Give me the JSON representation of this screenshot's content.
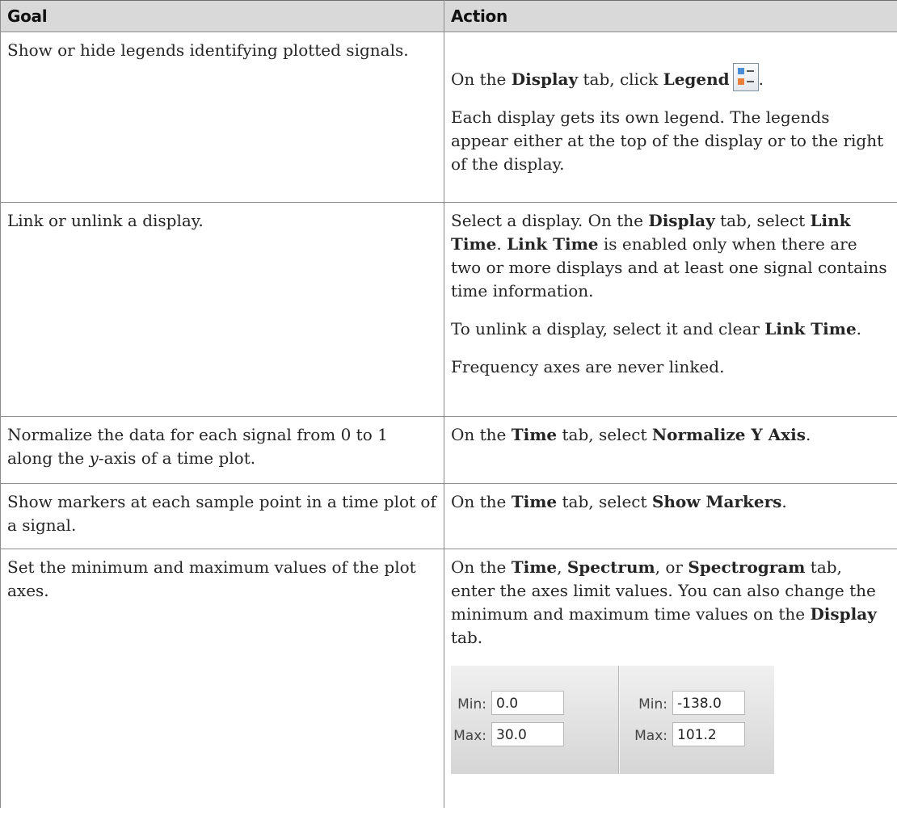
{
  "table": {
    "headers": {
      "goal": "Goal",
      "action": "Action"
    },
    "rows": [
      {
        "goal": "Show or hide legends identifying plotted signals.",
        "action1": {
          "t1": "On the ",
          "b1": "Display",
          "t2": " tab, click ",
          "b2": "Legend",
          "icon": "legend-icon",
          "end": "."
        },
        "action2": "Each display gets its own legend. The legends appear either at the top of the display or to the right of the display."
      },
      {
        "goal": "Link or unlink a display.",
        "action1": {
          "t1": "Select a display. On the ",
          "b1": "Display",
          "t2": " tab, select ",
          "b2": "Link Time",
          "t3": ". ",
          "b3": "Link Time",
          "t4": " is enabled only when there are two or more displays and at least one signal contains time information."
        },
        "action2": {
          "t1": "To unlink a display, select it and clear ",
          "b1": "Link Time",
          "end": "."
        },
        "action3": "Frequency axes are never linked."
      },
      {
        "goal": {
          "t1": "Normalize the data for each signal from 0 to 1 along the ",
          "i1": "y",
          "t2": "-axis of a time plot."
        },
        "action1": {
          "t1": "On the ",
          "b1": "Time",
          "t2": " tab, select ",
          "b2": "Normalize Y Axis",
          "end": "."
        }
      },
      {
        "goal": "Show markers at each sample point in a time plot of a signal.",
        "action1": {
          "t1": "On the ",
          "b1": "Time",
          "t2": " tab, select ",
          "b2": "Show Markers",
          "end": "."
        }
      },
      {
        "goal": "Set the minimum and maximum values of the plot axes.",
        "action1": {
          "b1": "Time",
          "t1": ", ",
          "b2": "Spectrum",
          "t2": ", or ",
          "b3": "Spectrogram",
          "t3": " tab, enter the axes limit values. You can also change the minimum and maximum time values on the ",
          "b4": "Display",
          "t4": " tab.",
          "t0": "On the "
        },
        "limits": {
          "left": {
            "min_label": "Min:",
            "min_value": "0.0",
            "max_label": "Max:",
            "max_value": "30.0"
          },
          "right": {
            "min_label": "Min:",
            "min_value": "-138.0",
            "max_label": "Max:",
            "max_value": "101.2"
          }
        }
      }
    ]
  }
}
